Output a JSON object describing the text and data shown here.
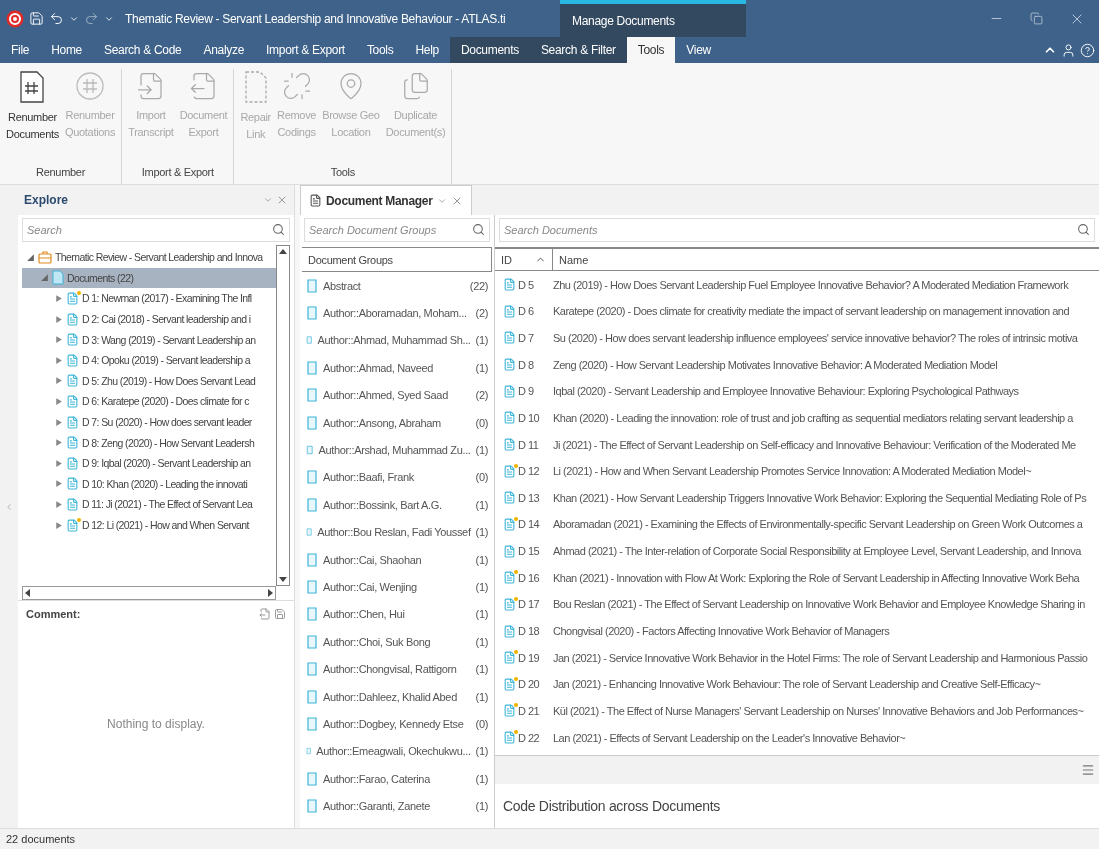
{
  "title_bar": {
    "title": "Thematic Review - Servant Leadership and Innovative Behaviour - ATLAS.ti"
  },
  "menu_tabs": [
    {
      "label": "File",
      "selected": false
    },
    {
      "label": "Home",
      "selected": false
    },
    {
      "label": "Search & Code",
      "selected": false
    },
    {
      "label": "Analyze",
      "selected": false
    },
    {
      "label": "Import & Export",
      "selected": false
    },
    {
      "label": "Tools",
      "selected": false
    },
    {
      "label": "Help",
      "selected": false
    }
  ],
  "context_group": {
    "title": "Manage Documents",
    "tabs": [
      {
        "label": "Documents",
        "selected": false
      },
      {
        "label": "Search & Filter",
        "selected": false
      },
      {
        "label": "Tools",
        "selected": true
      },
      {
        "label": "View",
        "selected": false
      }
    ]
  },
  "ribbon": {
    "groups": [
      {
        "label": "Renumber",
        "buttons": [
          {
            "lines": [
              "Renumber",
              "Documents"
            ],
            "disabled": false
          },
          {
            "lines": [
              "Renumber",
              "Quotations"
            ],
            "disabled": true
          }
        ]
      },
      {
        "label": "Import & Export",
        "buttons": [
          {
            "lines": [
              "Import",
              "Transcript"
            ],
            "disabled": true
          },
          {
            "lines": [
              "Document",
              "Export"
            ],
            "disabled": true
          }
        ]
      },
      {
        "label": "Tools",
        "buttons": [
          {
            "lines": [
              "Repair",
              "Link"
            ],
            "disabled": true
          },
          {
            "lines": [
              "Remove",
              "Codings"
            ],
            "disabled": true
          },
          {
            "lines": [
              "Browse Geo",
              "Location"
            ],
            "disabled": true
          },
          {
            "lines": [
              "Duplicate",
              "Document(s)"
            ],
            "disabled": true
          }
        ]
      }
    ]
  },
  "explore": {
    "title": "Explore",
    "search": {
      "placeholder": "Search"
    },
    "tree": [
      {
        "kind": "project",
        "label": "Thematic Review - Servant Leadership and Innova",
        "expanded": true,
        "selected": false,
        "children": [
          {
            "kind": "folder",
            "label": "Documents (22)",
            "expanded": true,
            "selected": true,
            "children": [
              {
                "kind": "document",
                "label": "D 1: Newman (2017) - Examining The Infl",
                "commented": true,
                "expanded": false,
                "selected": false
              },
              {
                "kind": "document",
                "label": "D 2: Cai (2018) - Servant leadership and i",
                "commented": false,
                "expanded": false,
                "selected": false
              },
              {
                "kind": "document",
                "label": "D 3: Wang (2019) - Servant Leadership an",
                "commented": false,
                "expanded": false,
                "selected": false
              },
              {
                "kind": "document",
                "label": "D 4: Opoku (2019) - Servant leadership a",
                "commented": false,
                "expanded": false,
                "selected": false
              },
              {
                "kind": "document",
                "label": "D 5: Zhu (2019) - How Does Servant Lead",
                "commented": false,
                "expanded": false,
                "selected": false
              },
              {
                "kind": "document",
                "label": "D 6: Karatepe (2020) - Does climate for c",
                "commented": false,
                "expanded": false,
                "selected": false
              },
              {
                "kind": "document",
                "label": "D 7: Su (2020) - How does servant leader",
                "commented": false,
                "expanded": false,
                "selected": false
              },
              {
                "kind": "document",
                "label": "D 8: Zeng (2020) - How Servant Leadersh",
                "commented": false,
                "expanded": false,
                "selected": false
              },
              {
                "kind": "document",
                "label": "D 9: Iqbal (2020) - Servant Leadership an",
                "commented": false,
                "expanded": false,
                "selected": false
              },
              {
                "kind": "document",
                "label": "D 10: Khan (2020) - Leading the innovati",
                "commented": false,
                "expanded": false,
                "selected": false
              },
              {
                "kind": "document",
                "label": "D 11: Ji (2021) - The Effect of Servant Lea",
                "commented": false,
                "expanded": false,
                "selected": false
              },
              {
                "kind": "document",
                "label": "D 12: Li (2021) - How and When Servant",
                "commented": true,
                "expanded": false,
                "selected": false
              }
            ]
          }
        ]
      }
    ]
  },
  "comment": {
    "title": "Comment:",
    "empty_text": "Nothing to display."
  },
  "document_manager": {
    "tab": "Document Manager",
    "groups": {
      "search": {
        "placeholder": "Search Document Groups"
      },
      "header": "Document Groups",
      "items": [
        {
          "name": "Abstract",
          "count": "(22)"
        },
        {
          "name": "Author::Aboramadan, Moham...",
          "count": "(2)"
        },
        {
          "name": "Author::Ahmad, Muhammad Sh...",
          "count": "(1)"
        },
        {
          "name": "Author::Ahmad, Naveed",
          "count": "(1)"
        },
        {
          "name": "Author::Ahmed, Syed Saad",
          "count": "(2)"
        },
        {
          "name": "Author::Ansong, Abraham",
          "count": "(0)"
        },
        {
          "name": "Author::Arshad, Muhammad Zu...",
          "count": "(1)"
        },
        {
          "name": "Author::Baafi, Frank",
          "count": "(0)"
        },
        {
          "name": "Author::Bossink, Bart A.G.",
          "count": "(1)"
        },
        {
          "name": "Author::Bou Reslan, Fadi Youssef",
          "count": "(1)"
        },
        {
          "name": "Author::Cai, Shaohan",
          "count": "(1)"
        },
        {
          "name": "Author::Cai, Wenjing",
          "count": "(1)"
        },
        {
          "name": "Author::Chen, Hui",
          "count": "(1)"
        },
        {
          "name": "Author::Choi, Suk Bong",
          "count": "(1)"
        },
        {
          "name": "Author::Chongvisal, Rattigorn",
          "count": "(1)"
        },
        {
          "name": "Author::Dahleez, Khalid Abed",
          "count": "(1)"
        },
        {
          "name": "Author::Dogbey, Kennedy Etse",
          "count": "(0)"
        },
        {
          "name": "Author::Emeagwali, Okechukwu...",
          "count": "(1)"
        },
        {
          "name": "Author::Farao, Caterina",
          "count": "(1)"
        },
        {
          "name": "Author::Garanti, Zanete",
          "count": "(1)"
        }
      ]
    },
    "documents": {
      "search": {
        "placeholder": "Search Documents"
      },
      "columns": [
        {
          "label": "ID",
          "sorted": true
        },
        {
          "label": "Name",
          "sorted": false
        }
      ],
      "rows": [
        {
          "id": "D 5",
          "name": "Zhu (2019) - How Does Servant Leadership Fuel Employee Innovative Behavior? A Moderated Mediation Framework",
          "commented": false
        },
        {
          "id": "D 6",
          "name": "Karatepe (2020) - Does climate for creativity mediate the impact of servant leadership on management innovation and",
          "commented": false
        },
        {
          "id": "D 7",
          "name": "Su (2020) - How does servant leadership influence employees' service innovative behavior? The roles of intrinsic motiva",
          "commented": false
        },
        {
          "id": "D 8",
          "name": "Zeng (2020) - How Servant Leadership Motivates Innovative Behavior: A Moderated Mediation Model",
          "commented": false
        },
        {
          "id": "D 9",
          "name": "Iqbal (2020) - Servant Leadership and Employee Innovative Behaviour: Exploring Psychological Pathways",
          "commented": false
        },
        {
          "id": "D 10",
          "name": "Khan (2020) - Leading the innovation: role of trust and job crafting as sequential mediators relating servant leadership a",
          "commented": false
        },
        {
          "id": "D 11",
          "name": "Ji (2021) - The Effect of Servant Leadership on Self-efficacy and Innovative Behaviour: Verification of the Moderated Me",
          "commented": false
        },
        {
          "id": "D 12",
          "name": "Li (2021) - How and When Servant Leadership Promotes Service Innovation: A Moderated Mediation Model~",
          "commented": true
        },
        {
          "id": "D 13",
          "name": "Khan (2021) - How Servant Leadership Triggers Innovative Work Behavior: Exploring the Sequential Mediating Role of Ps",
          "commented": false
        },
        {
          "id": "D 14",
          "name": "Aboramadan (2021) - Examining the Effects of Environmentally-specific Servant Leadership on Green Work Outcomes a",
          "commented": true
        },
        {
          "id": "D 15",
          "name": "Ahmad (2021) - The Inter-relation of Corporate Social Responsibility at Employee Level, Servant Leadership, and Innova",
          "commented": false
        },
        {
          "id": "D 16",
          "name": "Khan (2021) - Innovation with Flow At Work: Exploring the Role of Servant Leadership in Affecting Innovative Work Beha",
          "commented": true
        },
        {
          "id": "D 17",
          "name": "Bou Reslan (2021) - The Effect of Servant Leadership on Innovative Work Behavior and Employee Knowledge Sharing in",
          "commented": true
        },
        {
          "id": "D 18",
          "name": "Chongvisal (2020) - Factors Affecting Innovative Work Behavior of Managers",
          "commented": false
        },
        {
          "id": "D 19",
          "name": "Jan (2021) - Service Innovative Work Behavior in the Hotel Firms: The role of Servant Leadership and Harmonious Passio",
          "commented": true
        },
        {
          "id": "D 20",
          "name": "Jan (2021) - Enhancing Innovative Work Behaviour: The role of Servant Leadership and Creative Self-Efficacy~",
          "commented": true
        },
        {
          "id": "D 21",
          "name": "Kül (2021) - The Effect of Nurse Managers' Servant Leadership on Nurses' Innovative Behaviors and Job Performances~",
          "commented": true
        },
        {
          "id": "D 22",
          "name": "Lan (2021) - Effects of Servant Leadership on the Leader's Innovative Behavior~",
          "commented": true
        }
      ]
    },
    "chart_title": "Code Distribution across Documents"
  },
  "status_bar": {
    "text": "22 documents"
  }
}
